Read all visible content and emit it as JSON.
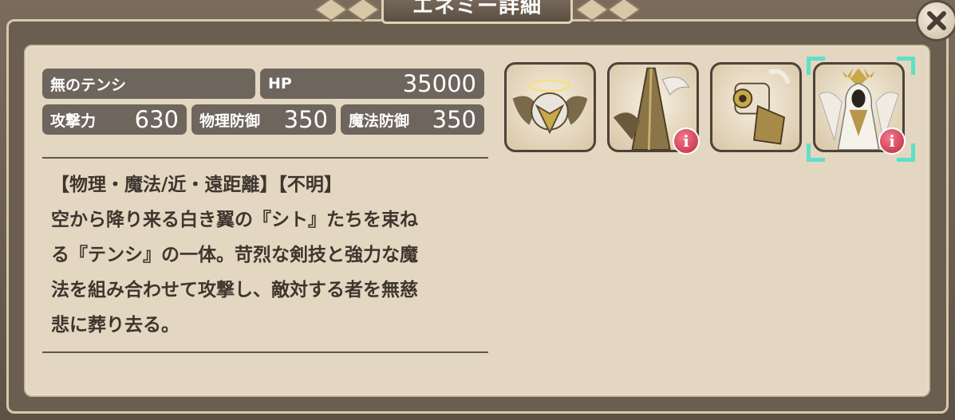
{
  "window": {
    "title": "エネミー詳細",
    "close_icon": "close-icon"
  },
  "stats": {
    "name": "無のテンシ",
    "hp_label": "HP",
    "hp_value": "35000",
    "attack_label": "攻撃力",
    "attack_value": "630",
    "physical_defense_label": "物理防御",
    "physical_defense_value": "350",
    "magic_defense_label": "魔法防御",
    "magic_defense_value": "350"
  },
  "description": {
    "tags": "【物理・魔法/近・遠距離】【不明】",
    "lines": [
      "空から降り来る白き翼の『シト』たちを束ね",
      "る『テンシ』の一体。苛烈な剣技と強力な魔",
      "法を組み合わせて攻撃し、敵対する者を無慈",
      "悲に葬り去る。"
    ]
  },
  "portraits": [
    {
      "icon": "winged-helmet-icon",
      "has_info": false,
      "selected": false
    },
    {
      "icon": "spire-wing-icon",
      "has_info": true,
      "selected": false
    },
    {
      "icon": "armored-cannon-icon",
      "has_info": false,
      "selected": false
    },
    {
      "icon": "angel-figure-icon",
      "has_info": true,
      "selected": true
    }
  ],
  "info_badge_text": "i",
  "colors": {
    "panel": "#e4d7c1",
    "pill": "#6e655d",
    "selection": "#5fe0c8",
    "info_badge": "#d6364e"
  }
}
